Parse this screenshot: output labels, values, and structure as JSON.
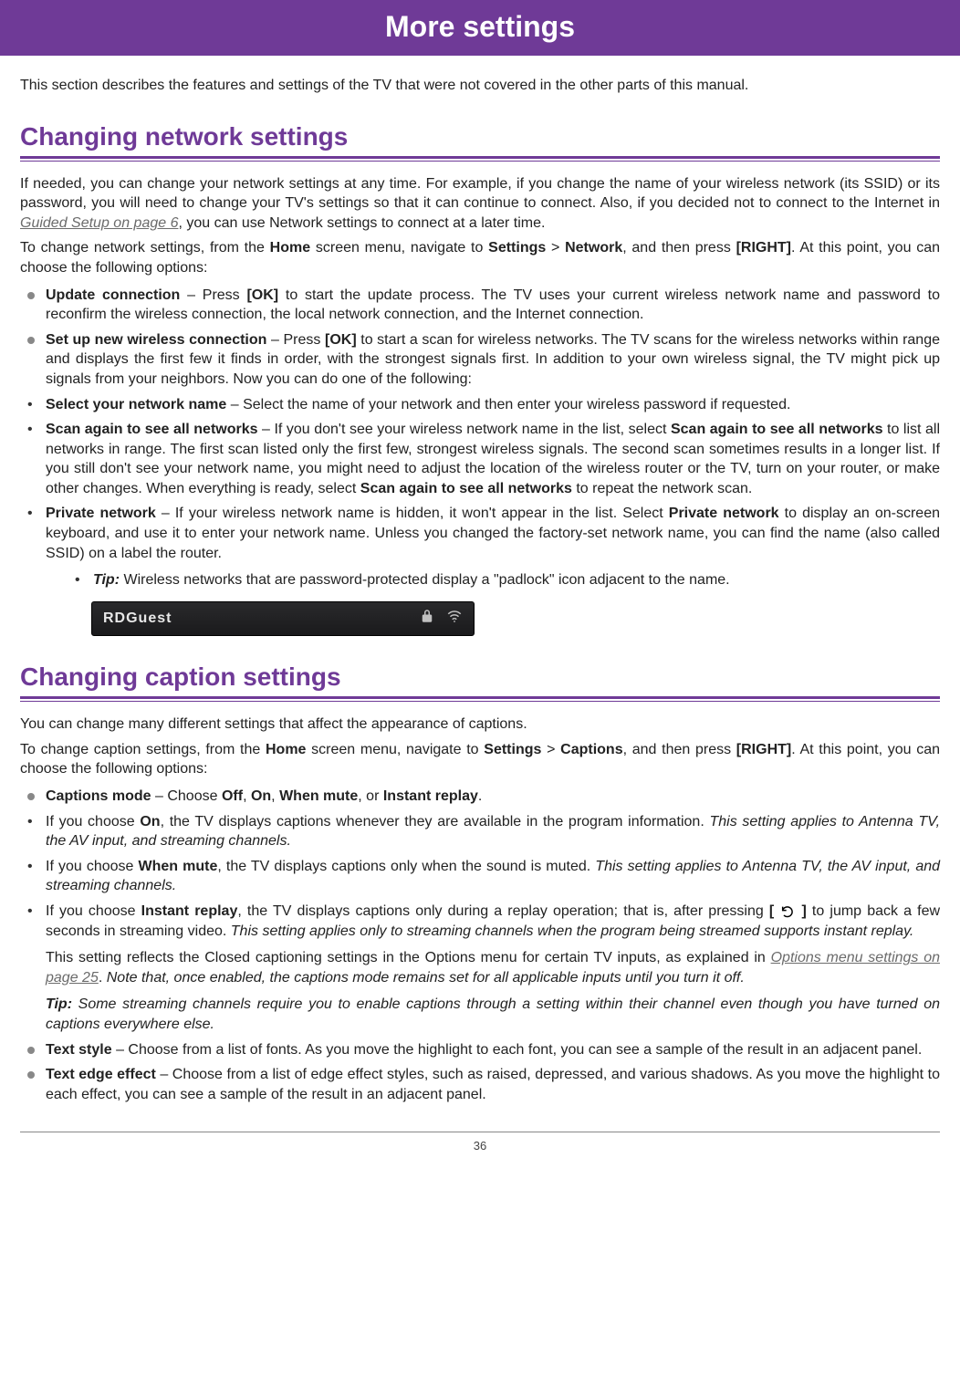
{
  "title": "More settings",
  "intro": "This section describes the features and settings of the TV that were not covered in the other parts of this manual.",
  "sections": {
    "network": {
      "heading": "Changing network settings",
      "p1a": "If needed, you can change your network settings at any time. For example, if you change the name of your wireless network (its SSID) or its password, you will need to change your TV's settings so that it can continue to connect. Also, if you decided not to connect to the Internet in ",
      "p1link": "Guided Setup on page 6",
      "p1b": ", you can use Network settings to connect at a later time.",
      "p2a": "To change network settings, from the ",
      "p2b": "Home",
      "p2c": " screen menu, navigate to ",
      "p2d": "Settings",
      "p2e": " > ",
      "p2f": "Network",
      "p2g": ", and then press ",
      "p2h": "[RIGHT]",
      "p2i": ". At this point, you can choose the following options:",
      "items": {
        "update_label": "Update connection",
        "update_text": " – Press ",
        "update_ok": "[OK]",
        "update_rest": " to start the update process. The TV uses your current wireless network name and password to reconfirm the wireless connection, the local network connection, and the Internet connection.",
        "setup_label": "Set up new wireless connection",
        "setup_text": " – Press ",
        "setup_ok": "[OK]",
        "setup_rest": " to start a scan for wireless networks. The TV scans for the wireless networks within range and displays the first few it finds in order, with the strongest signals first. In addition to your own wireless signal, the TV might pick up signals from your neighbors. Now you can do one of the following:",
        "select_label": "Select your network name",
        "select_text": " – Select the name of your network and then enter your wireless password if requested.",
        "scan_label": "Scan again to see all networks",
        "scan_text_a": " – If you don't see your wireless network name in the list, select ",
        "scan_bold1": "Scan again to see all networks",
        "scan_text_b": " to list all networks in range. The first scan listed only the first few, strongest wireless signals. The second scan sometimes results in a longer list. If you still don't see your network name, you might need to adjust the location of the wireless router or the TV, turn on your router, or make other changes. When everything is ready, select ",
        "scan_bold2": "Scan again to see all networks",
        "scan_text_c": " to repeat the network scan.",
        "private_label": "Private network",
        "private_text_a": " – If your wireless network name is hidden, it won't appear in the list. Select ",
        "private_bold": "Private network",
        "private_text_b": " to display an on-screen keyboard, and use it to enter your network name. Unless you changed the factory-set network name, you can find the name (also called SSID) on a label the router.",
        "tip_label": "Tip:",
        "tip_text": " Wireless networks that are password-protected display a \"padlock\" icon adjacent to the name."
      },
      "wifi_name": "RDGuest"
    },
    "caption": {
      "heading": "Changing caption settings",
      "p1": "You can change many different settings that affect the appearance of captions.",
      "p2a": "To change caption settings, from the ",
      "p2b": "Home",
      "p2c": " screen menu, navigate to ",
      "p2d": "Settings",
      "p2e": " > ",
      "p2f": "Captions",
      "p2g": ", and then press ",
      "p2h": "[RIGHT]",
      "p2i": ". At this point, you can choose the following options:",
      "items": {
        "mode_label": "Captions mode",
        "mode_text_a": " – Choose ",
        "mode_off": "Off",
        "mode_on": "On",
        "mode_whenmute": "When mute",
        "mode_instant": "Instant replay",
        "on_a": "If you choose ",
        "on_b": "On",
        "on_c": ", the TV displays captions whenever they are available in the program information. ",
        "on_d": "This setting applies to Antenna TV, the AV input, and streaming channels.",
        "whenmute_a": "If you choose ",
        "whenmute_b": "When mute",
        "whenmute_c": ", the TV displays captions only when the sound is muted. ",
        "whenmute_d": "This setting applies to Antenna TV, the AV input, and streaming channels.",
        "instant_a": "If you choose ",
        "instant_b": "Instant replay",
        "instant_c": ", the TV displays captions only during a replay operation; that is, after pressing ",
        "instant_d": "[ ",
        "instant_e": " ]",
        "instant_f": " to jump back a few seconds in streaming video. ",
        "instant_g": "This setting applies only to streaming channels when the program being streamed supports instant replay.",
        "reflect_a": "This setting reflects the Closed captioning settings in the Options menu for certain TV inputs, as explained in ",
        "reflect_link": "Options menu settings on page 25",
        "reflect_b": ". ",
        "reflect_c": "Note that, once enabled, the captions mode remains set for all applicable inputs until you turn it off.",
        "tip_label": "Tip:",
        "tip_text": " Some streaming channels require you to enable captions through a setting within their channel even though you have turned on captions everywhere else.",
        "textstyle_label": "Text style",
        "textstyle_text": " – Choose from a list of fonts. As you move the highlight to each font, you can see a sample of the result in an adjacent panel.",
        "edge_label": "Text edge effect",
        "edge_text": " – Choose from a list of edge effect styles, such as raised, depressed, and various shadows. As you move the highlight to each effect, you can see a sample of the result in an adjacent panel."
      }
    }
  },
  "page_number": "36"
}
